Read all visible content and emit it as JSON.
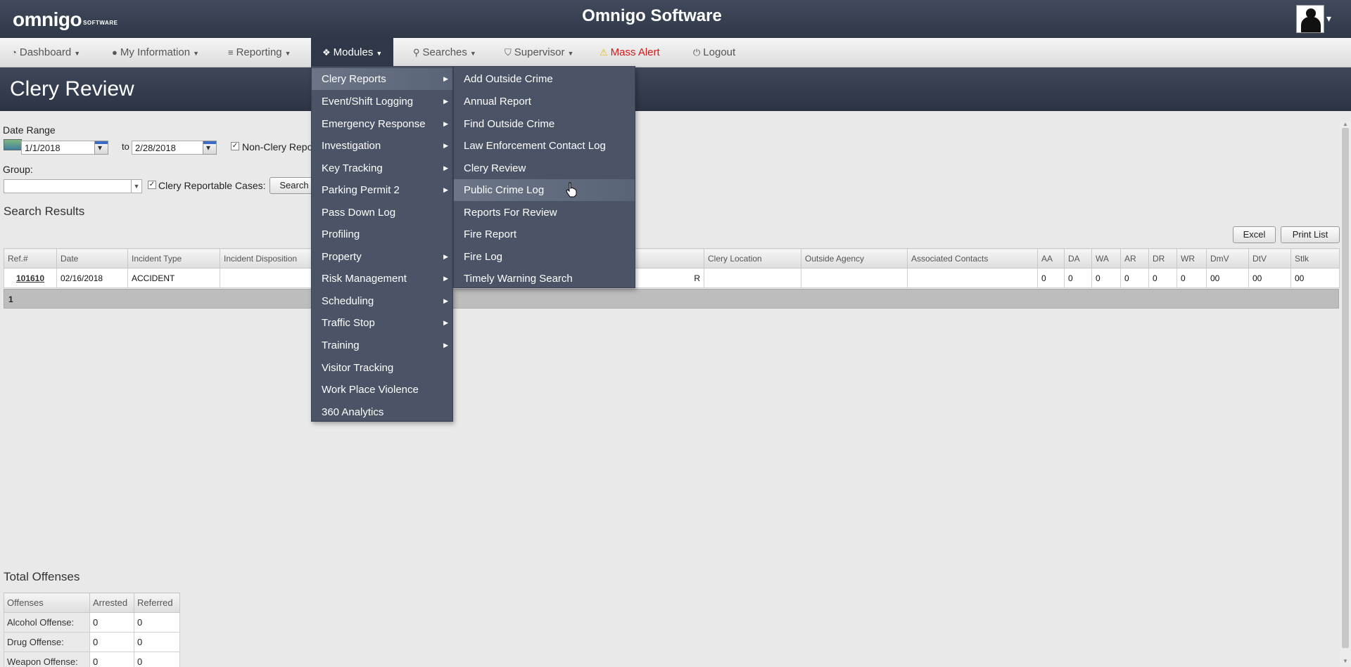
{
  "app": {
    "title": "Omnigo Software",
    "logo_text": "omnigo",
    "logo_sub": "SOFTWARE"
  },
  "nav": {
    "dashboard": "Dashboard",
    "my_information": "My Information",
    "reporting": "Reporting",
    "modules": "Modules",
    "searches": "Searches",
    "supervisor": "Supervisor",
    "mass_alert": "Mass Alert",
    "logout": "Logout"
  },
  "page": {
    "title": "Clery Review"
  },
  "form": {
    "date_range_label": "Date Range",
    "date_from": "1/1/2018",
    "to_label": "to",
    "date_to": "2/28/2018",
    "non_clery_label": "Non-Clery Repo",
    "group_label": "Group:",
    "group_value": "",
    "clery_reportable_label": "Clery Reportable Cases:",
    "search_button": "Search"
  },
  "results": {
    "heading": "Search Results",
    "excel_button": "Excel",
    "print_button": "Print List",
    "columns": [
      "Ref.#",
      "Date",
      "Incident Type",
      "Incident Disposition",
      "",
      "Clery Location",
      "Outside Agency",
      "Associated Contacts",
      "AA",
      "DA",
      "WA",
      "AR",
      "DR",
      "WR",
      "DmV",
      "DtV",
      "Stlk"
    ],
    "rows": [
      {
        "ref": "101610",
        "date": "02/16/2018",
        "incident_type": "ACCIDENT",
        "incident_disposition": "",
        "hidden_col": "R",
        "clery_location": "",
        "outside_agency": "",
        "associated_contacts": "",
        "aa": "0",
        "da": "0",
        "wa": "0",
        "ar": "0",
        "dr": "0",
        "wr": "0",
        "dmv": "00",
        "dtv": "00",
        "stlk": "00"
      }
    ],
    "page": "1"
  },
  "offenses": {
    "heading": "Total Offenses",
    "columns": [
      "Offenses",
      "Arrested",
      "Referred"
    ],
    "rows": [
      {
        "label": "Alcohol Offense:",
        "arrested": "0",
        "referred": "0"
      },
      {
        "label": "Drug Offense:",
        "arrested": "0",
        "referred": "0"
      },
      {
        "label": "Weapon Offense:",
        "arrested": "0",
        "referred": "0"
      }
    ]
  },
  "modules_menu": {
    "items": [
      {
        "label": "Clery Reports",
        "submenu": true
      },
      {
        "label": "Event/Shift Logging",
        "submenu": true
      },
      {
        "label": "Emergency Response",
        "submenu": true
      },
      {
        "label": "Investigation",
        "submenu": true
      },
      {
        "label": "Key Tracking",
        "submenu": true
      },
      {
        "label": "Parking Permit 2",
        "submenu": true
      },
      {
        "label": "Pass Down Log",
        "submenu": false
      },
      {
        "label": "Profiling",
        "submenu": false
      },
      {
        "label": "Property",
        "submenu": true
      },
      {
        "label": "Risk Management",
        "submenu": true
      },
      {
        "label": "Scheduling",
        "submenu": true
      },
      {
        "label": "Traffic Stop",
        "submenu": true
      },
      {
        "label": "Training",
        "submenu": true
      },
      {
        "label": "Visitor Tracking",
        "submenu": false
      },
      {
        "label": "Work Place Violence",
        "submenu": false
      },
      {
        "label": "360 Analytics",
        "submenu": false
      }
    ]
  },
  "clery_submenu": {
    "items": [
      {
        "label": "Add Outside Crime"
      },
      {
        "label": "Annual Report"
      },
      {
        "label": "Find Outside Crime"
      },
      {
        "label": "Law Enforcement Contact Log"
      },
      {
        "label": "Clery Review"
      },
      {
        "label": "Public Crime Log"
      },
      {
        "label": "Reports For Review"
      },
      {
        "label": "Fire Report"
      },
      {
        "label": "Fire Log"
      },
      {
        "label": "Timely Warning Search"
      }
    ]
  },
  "colors": {
    "header_dark": "#2f3848",
    "menu_bg": "#4a5466",
    "mass_alert": "#d01a1a"
  }
}
